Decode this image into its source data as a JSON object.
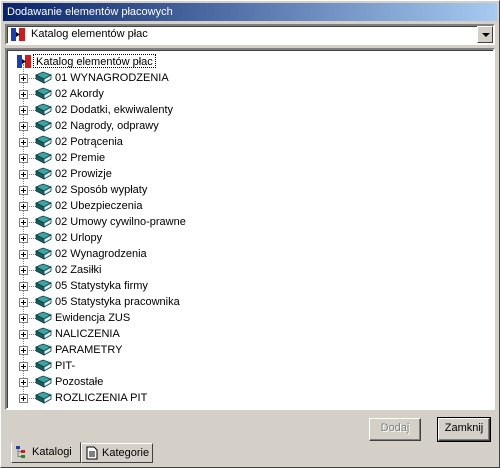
{
  "window": {
    "title": "Dodawanie elementów płacowych"
  },
  "catalog_select": {
    "value": "Katalog elementów płac"
  },
  "tree": {
    "root_label": "Katalog elementów płac",
    "items": [
      {
        "label": "01 WYNAGRODZENIA"
      },
      {
        "label": "02 Akordy"
      },
      {
        "label": "02 Dodatki, ekwiwalenty"
      },
      {
        "label": "02 Nagrody, odprawy"
      },
      {
        "label": "02 Potrącenia"
      },
      {
        "label": "02 Premie"
      },
      {
        "label": "02 Prowizje"
      },
      {
        "label": "02 Sposób wypłaty"
      },
      {
        "label": "02 Ubezpieczenia"
      },
      {
        "label": "02 Umowy cywilno-prawne"
      },
      {
        "label": "02 Urlopy"
      },
      {
        "label": "02 Wynagrodzenia"
      },
      {
        "label": "02 Zasiłki"
      },
      {
        "label": "05 Statystyka firmy"
      },
      {
        "label": "05 Statystyka pracownika"
      },
      {
        "label": "Ewidencja ZUS"
      },
      {
        "label": "NALICZENIA"
      },
      {
        "label": "PARAMETRY"
      },
      {
        "label": "PIT-"
      },
      {
        "label": "Pozostałe"
      },
      {
        "label": "ROZLICZENIA PIT"
      }
    ]
  },
  "buttons": {
    "add": "Dodaj",
    "close": "Zamknij"
  },
  "tabs": [
    {
      "label": "Katalogi",
      "icon": "tree-structure-icon"
    },
    {
      "label": "Kategorie",
      "icon": "document-icon"
    }
  ],
  "colors": {
    "title_bar": "#0a246a",
    "book_icon": "#1b6b6b",
    "window_bg": "#d4d0c8"
  }
}
